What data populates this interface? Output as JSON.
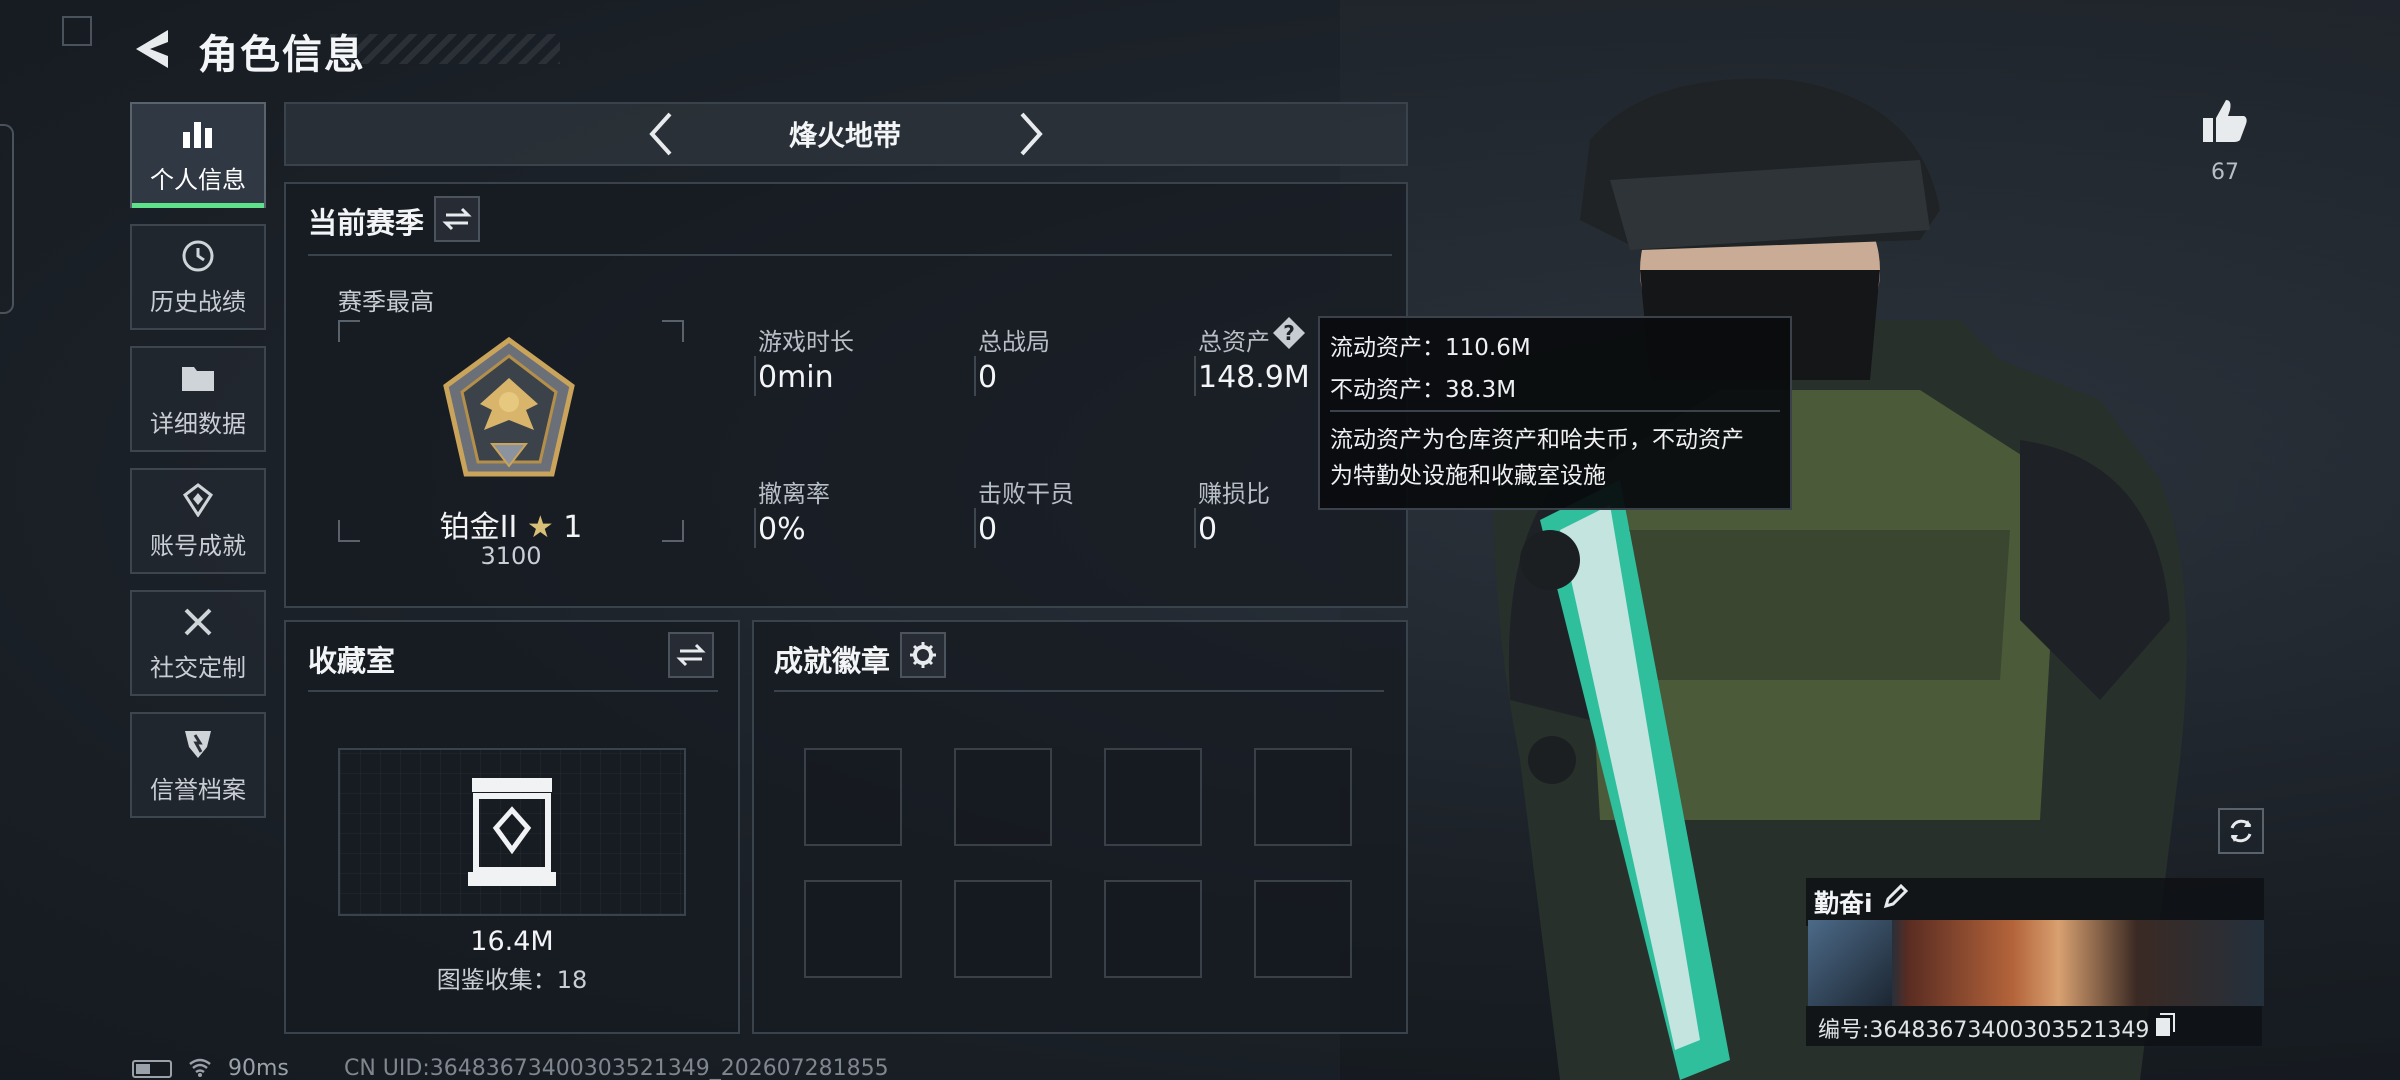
{
  "header": {
    "title": "角色信息"
  },
  "sidebar": {
    "items": [
      {
        "label": "个人信息",
        "icon": "bar-chart-icon",
        "active": true
      },
      {
        "label": "历史战绩",
        "icon": "history-clock-icon"
      },
      {
        "label": "详细数据",
        "icon": "folder-icon"
      },
      {
        "label": "账号成就",
        "icon": "achievement-icon"
      },
      {
        "label": "社交定制",
        "icon": "tools-icon"
      },
      {
        "label": "信誉档案",
        "icon": "shield-icon"
      }
    ]
  },
  "mode_selector": {
    "label": "烽火地带"
  },
  "season": {
    "title": "当前赛季",
    "best_label": "赛季最高",
    "rank_name": "铂金II",
    "rank_stars": "1",
    "rank_score": "3100",
    "stats": [
      {
        "label": "游戏时长",
        "value": "0min"
      },
      {
        "label": "总战局",
        "value": "0"
      },
      {
        "label": "总资产",
        "value": "148.9M"
      },
      {
        "label": "撤离率",
        "value": "0%"
      },
      {
        "label": "击败干员",
        "value": "0"
      },
      {
        "label": "赚损比",
        "value": "0"
      }
    ]
  },
  "tooltip": {
    "liquid": "流动资产：110.6M",
    "fixed": "不动资产：38.3M",
    "desc_line1": "流动资产为仓库资产和哈夫币，不动资产",
    "desc_line2": "为特勤处设施和收藏室设施"
  },
  "collection": {
    "title": "收藏室",
    "value": "16.4M",
    "count_label": "图鉴收集：18"
  },
  "badges": {
    "title": "成就徽章"
  },
  "likes": {
    "count": "67"
  },
  "player": {
    "name": "勤奋i",
    "id_text": "编号:364836734003035213​49"
  },
  "status": {
    "ping": "90ms",
    "uid": "CN UID:364836734003035213​49_202607281855"
  },
  "colors": {
    "accent_green": "#5fe08a",
    "weapon_teal": "#2fbf9c",
    "panel_border": "#3a424c"
  }
}
